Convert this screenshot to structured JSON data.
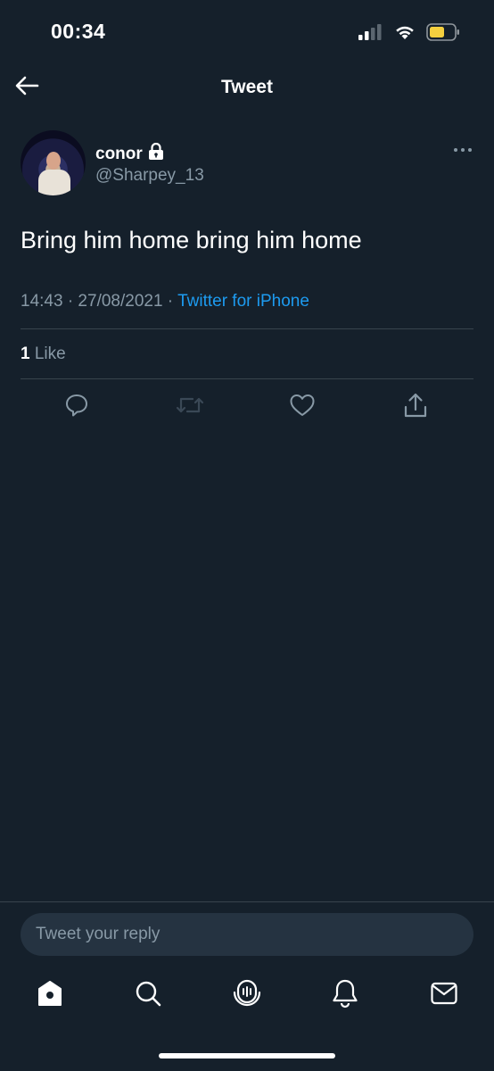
{
  "status_bar": {
    "time": "00:34",
    "icons": [
      "signal-icon",
      "wifi-icon",
      "battery-icon"
    ],
    "battery_color": "#f4d03f"
  },
  "header": {
    "title": "Tweet",
    "back_icon": "arrow-left-icon"
  },
  "tweet": {
    "display_name": "conor",
    "protected_icon": "lock-icon",
    "handle": "@Sharpey_13",
    "text": "Bring him home bring him home",
    "timestamp": "14:43 · 27/08/2021 · ",
    "source": "Twitter for iPhone",
    "like_count": "1",
    "like_label": " Like",
    "more_icon": "more-icon"
  },
  "actions": [
    {
      "name": "reply",
      "icon": "comment-icon"
    },
    {
      "name": "retweet",
      "icon": "retweet-icon"
    },
    {
      "name": "like",
      "icon": "heart-icon"
    },
    {
      "name": "share",
      "icon": "share-icon"
    }
  ],
  "reply": {
    "placeholder": "Tweet your reply"
  },
  "tab_bar": {
    "items": [
      "home-icon",
      "search-icon",
      "spaces-icon",
      "notifications-icon",
      "messages-icon"
    ]
  },
  "colors": {
    "background": "#15202b",
    "accent": "#1d9bf0",
    "secondary_text": "#8899a6",
    "divider": "#38444d"
  }
}
